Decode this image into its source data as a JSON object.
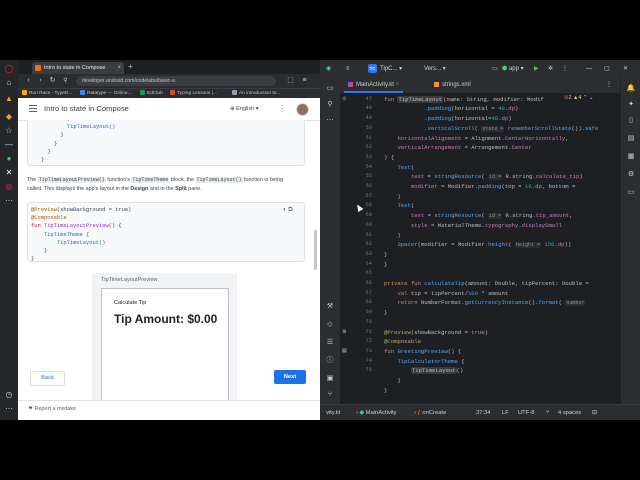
{
  "browser": {
    "tab_title": "Intro to state in Compose",
    "url": "developer.android.com/codelabs/basic-a",
    "bookmarks": [
      "Run Race - TypeR...",
      "Ratatype — Online...",
      "EdClub",
      "Typing Lessons |...",
      "An introduction to..."
    ]
  },
  "page": {
    "title": "Intro to state in Compose",
    "language": "English",
    "code_top": [
      "        )",
      "        TipTimeLayout()",
      "      }",
      "    }",
      "  }",
      "}"
    ],
    "paragraph": {
      "p1": "The ",
      "c1": "TipTimeLayoutPreview()",
      "p2": " function's ",
      "c2": "TipTimeTheme",
      "p3": " block, the ",
      "c3": "TipTimeLayout()",
      "p4": " function is being called. This displays the app's layout in the ",
      "b1": "Design",
      "p5": " and in the ",
      "b2": "Split",
      "p6": " pane."
    },
    "preview_code": {
      "l1a": "@Preview",
      "l1b": "(showBackground = true)",
      "l2": "@Composable",
      "l3a": "fun ",
      "l3b": "TipTimeLayoutPreview",
      "l3c": "() {",
      "l4": "    TipTimeTheme {",
      "l5": "        TipTimeLayout()",
      "l6": "    }",
      "l7": "}"
    },
    "preview_label": "TipTimeLayoutPreview",
    "calculate_tip": "Calculate Tip",
    "tip_amount": "Tip Amount: $0.00",
    "back_button": "Back",
    "next_button": "Next",
    "report": "Report a mistake"
  },
  "ide": {
    "project": "TC",
    "project_name": "TipC...",
    "vcs": "Vers...",
    "run_config": "app",
    "tabs": [
      "MainActivity.kt",
      "strings.xml"
    ],
    "diagnostics": {
      "errors": "2",
      "warnings": "4"
    },
    "lines": [
      "46",
      "47",
      "48",
      "49",
      "50",
      "51",
      "52",
      "53",
      "54",
      "55",
      "56",
      "57",
      "58",
      "59",
      "60",
      "61",
      "62",
      "63",
      "64",
      "65",
      "66",
      "67",
      "68",
      "69",
      "70",
      "71",
      "72",
      "73",
      "74",
      "75"
    ],
    "status": {
      "file": "vity.kt",
      "class": "MainActivity",
      "method": "onCreate",
      "position": "37:34",
      "line_sep": "LF",
      "encoding": "UTF-8",
      "indent": "4 spaces"
    }
  }
}
